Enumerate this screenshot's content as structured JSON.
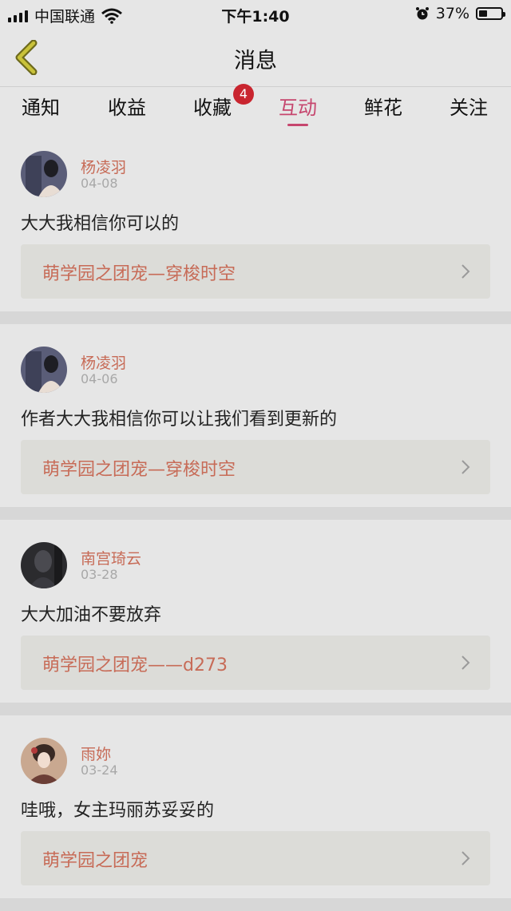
{
  "status_bar": {
    "carrier": "中国联通",
    "time": "下午1:40",
    "battery_text": "37%",
    "battery_level": 0.37
  },
  "nav": {
    "title": "消息"
  },
  "tabs": [
    {
      "label": "通知"
    },
    {
      "label": "收益"
    },
    {
      "label": "收藏",
      "badge": "4"
    },
    {
      "label": "互动"
    },
    {
      "label": "鲜花"
    },
    {
      "label": "关注"
    }
  ],
  "active_tab": "互动",
  "colors": {
    "accent": "#c6466e",
    "name": "#c76b57",
    "badge": "#c9252f"
  },
  "feed": [
    {
      "user": "杨凌羽",
      "date": "04-08",
      "comment": "大大我相信你可以的",
      "book": "萌学园之团宠—穿梭时空"
    },
    {
      "user": "杨凌羽",
      "date": "04-06",
      "comment": "作者大大我相信你可以让我们看到更新的",
      "book": "萌学园之团宠—穿梭时空"
    },
    {
      "user": "南宫琦云",
      "date": "03-28",
      "comment": "大大加油不要放弃",
      "book": "萌学园之团宠——d273"
    },
    {
      "user": "雨妳",
      "date": "03-24",
      "comment": "哇哦，女主玛丽苏妥妥的",
      "book": "萌学园之团宠"
    }
  ]
}
